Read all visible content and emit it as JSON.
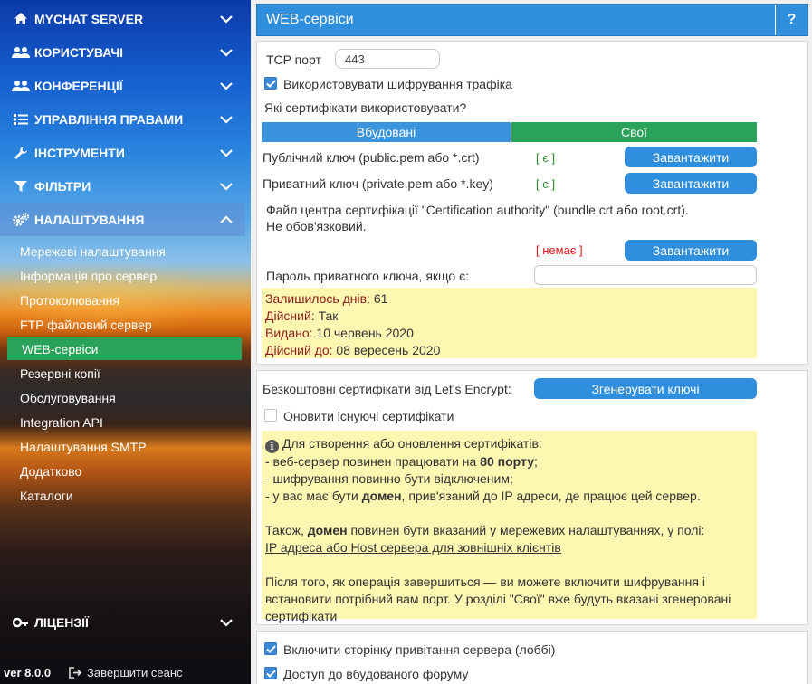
{
  "sidebar": {
    "sections": [
      {
        "label": "MYCHAT SERVER",
        "icon": "home-icon",
        "expanded": false
      },
      {
        "label": "КОРИСТУВАЧІ",
        "icon": "users-icon",
        "expanded": false
      },
      {
        "label": "КОНФЕРЕНЦІЇ",
        "icon": "conferences-icon",
        "expanded": false
      },
      {
        "label": "УПРАВЛІННЯ ПРАВАМИ",
        "icon": "list-icon",
        "expanded": false
      },
      {
        "label": "ІНСТРУМЕНТИ",
        "icon": "wrench-icon",
        "expanded": false
      },
      {
        "label": "ФІЛЬТРИ",
        "icon": "filter-icon",
        "expanded": false
      },
      {
        "label": "НАЛАШТУВАННЯ",
        "icon": "gears-icon",
        "expanded": true
      }
    ],
    "settings_items": [
      "Мережеві налаштування",
      "Інформація про сервер",
      "Протоколювання",
      "FTP файловий сервер",
      "WEB-сервіси",
      "Резервні копії",
      "Обслуговування",
      "Integration API",
      "Налаштування SMTP",
      "Додатково",
      "Каталоги"
    ],
    "active_item": "WEB-сервіси",
    "licenses": {
      "label": "ЛІЦЕНЗІЇ",
      "icon": "key-icon"
    },
    "version": "ver 8.0.0",
    "logout_label": "Завершити сеанс"
  },
  "header": {
    "title": "WEB-сервіси",
    "help_label": "?"
  },
  "ssl_panel": {
    "tcp_port_label": "TCP порт",
    "tcp_port_value": "443",
    "use_encryption_label": "Використовувати шифрування трафіка",
    "use_encryption_checked": true,
    "which_certs_label": "Які сертифікати використовувати?",
    "tab_builtin": "Вбудовані",
    "tab_custom": "Свої",
    "selected_tab": "Свої",
    "public_key_label": "Публічний ключ (public.pem або *.crt)",
    "public_key_status": "[ є ]",
    "private_key_label": "Приватний ключ (private.pem або *.key)",
    "private_key_status": "[ є ]",
    "ca_label_line1": "Файл центра сертифікації \"Certification authority\" (bundle.crt або root.crt).",
    "ca_label_line2": "Не обов'язковий.",
    "ca_status": "[ немає ]",
    "upload_label": "Завантажити",
    "private_key_password_label": "Пароль приватного ключа, якщо є:",
    "private_key_password_value": "",
    "cert_info": {
      "days_left_label": "Залишилось днів:",
      "days_left_value": "61",
      "valid_label": "Дійсний:",
      "valid_value": "Так",
      "issued_label": "Видано:",
      "issued_value": "10 червень 2020",
      "valid_until_label": "Дійсний до:",
      "valid_until_value": "08 вересень 2020"
    },
    "colors": {
      "ok": "#2a8a2a",
      "missing": "#e01515",
      "builtin_tab": "#3a94dd",
      "custom_tab": "#2aa25a"
    }
  },
  "letsencrypt_panel": {
    "label": "Безкоштовні сертифікати від Let's Encrypt:",
    "generate_label": "Згенерувати ключі",
    "renew_label": "Оновити існуючі сертифікати",
    "renew_checked": false,
    "info": {
      "line1": "Для створення або оновлення сертифікатів:",
      "line2_pre": "- веб-сервер повинен працювати на ",
      "line2_bold": "80 порту",
      "line2_post": ";",
      "line3": "- шифрування повинно бути відключеним;",
      "line4_pre": "- у вас має бути ",
      "line4_bold": "домен",
      "line4_post": ", прив'язаний до IP адреси, де працює цей сервер.",
      "line5_pre": "Також, ",
      "line5_bold": "домен",
      "line5_post": " повинен бути вказаний у мережевих налаштуваннях, у полі:",
      "link": "IP адреса або Host сервера для зовнішніх клієнтів",
      "line7": "Після того, як операція завершиться — ви можете включити шифрування і",
      "line8": "встановити потрібний вам порт. У розділі \"Свої\" вже будуть вказані згенеровані",
      "line9": "сертифікати"
    }
  },
  "options_panel": {
    "lobby_label": "Включити сторінку привітання сервера (лоббі)",
    "lobby_checked": true,
    "forum_label": "Доступ до вбудованого форуму",
    "forum_checked": true
  }
}
